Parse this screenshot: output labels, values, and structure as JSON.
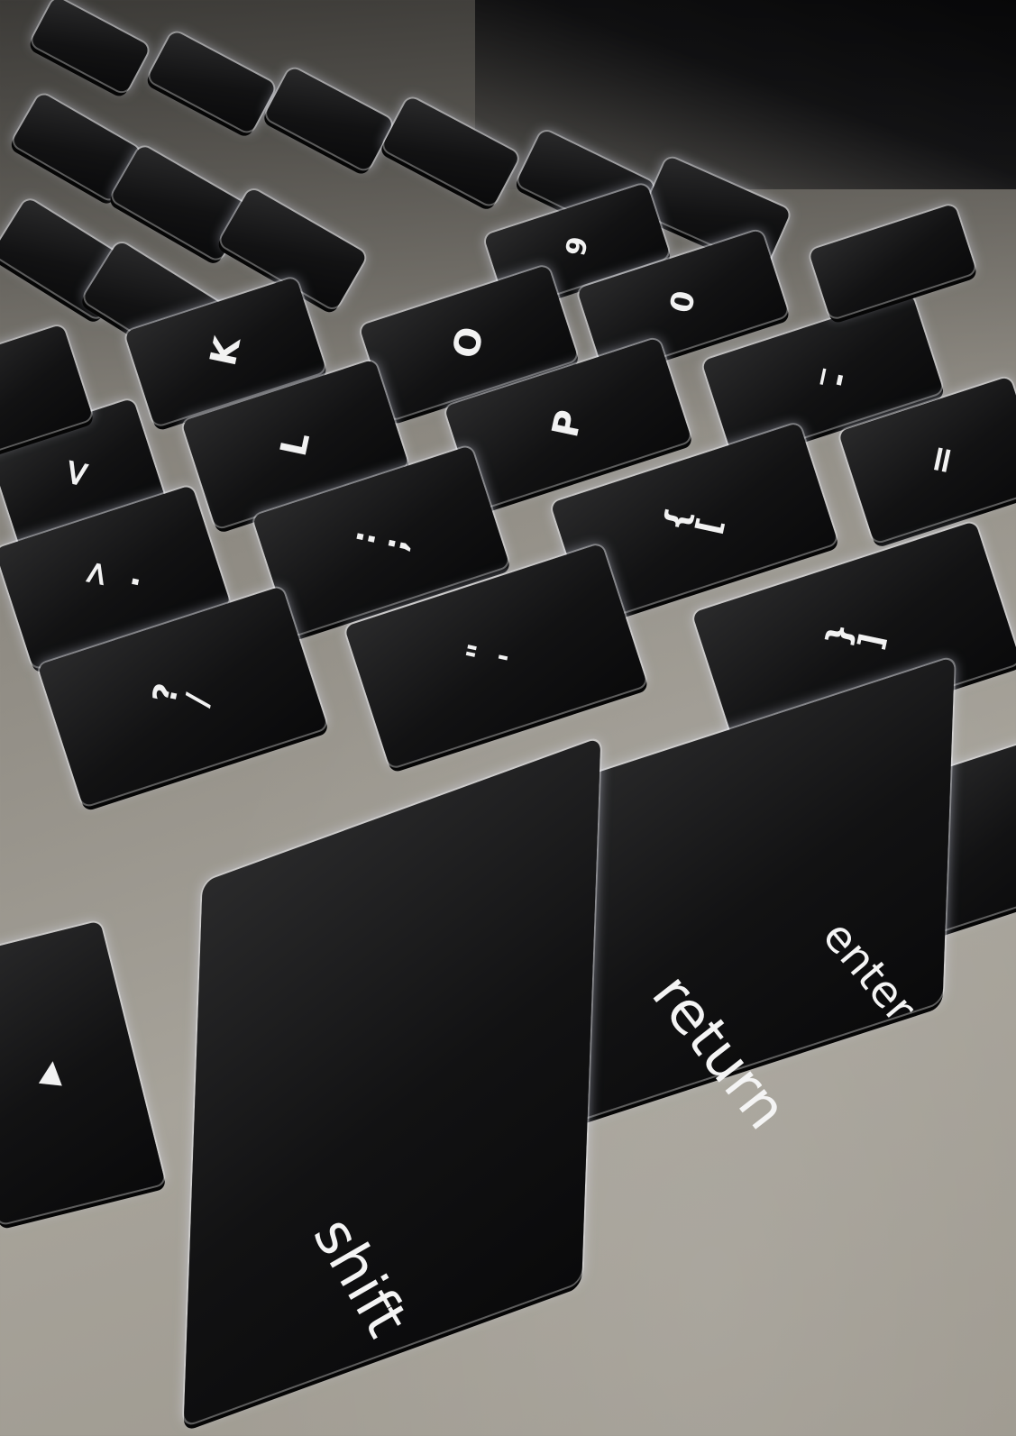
{
  "keys": {
    "k": "K",
    "l": "L",
    "o": "O",
    "p": "P",
    "zero": "0",
    "nine": "9",
    "minus_top": "_",
    "minus_bottom": "-",
    "equals": "=",
    "bracket_left_top": "{",
    "bracket_left_bottom": "[",
    "bracket_right_top": "}",
    "bracket_right_bottom": "]",
    "semicolon_top": ":",
    "semicolon_bottom": ";",
    "quote_top": "\"",
    "quote_bottom": "'",
    "comma_top": "<",
    "period_top": ">",
    "period_bottom": ".",
    "slash_top": "?",
    "slash_bottom": "/",
    "shift": "shift",
    "return": "return",
    "enter": "enter",
    "arrow_icon": "▶"
  },
  "colors": {
    "key_face": "#121213",
    "aluminum": "#a7a39a",
    "backlight": "#e6ebff"
  }
}
